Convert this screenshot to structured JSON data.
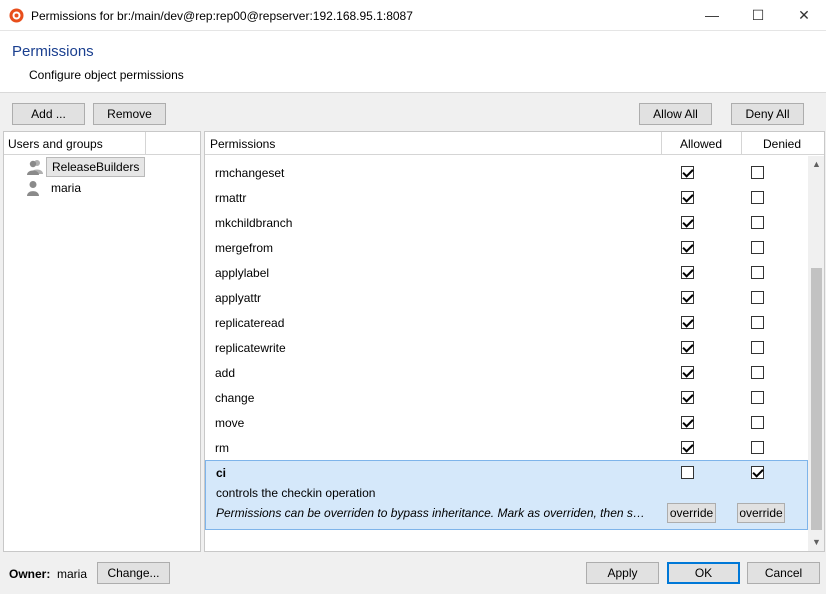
{
  "window": {
    "title": "Permissions for br:/main/dev@rep:rep00@repserver:192.168.95.1:8087",
    "minimize_glyph": "—",
    "maximize_glyph": "☐",
    "close_glyph": "✕"
  },
  "header": {
    "title": "Permissions",
    "subtitle": "Configure object permissions"
  },
  "toolbar": {
    "add_label": "Add ...",
    "remove_label": "Remove",
    "allow_all_label": "Allow All",
    "deny_all_label": "Deny All"
  },
  "users_panel": {
    "header": "Users and groups",
    "items": [
      {
        "label": "ReleaseBuilders",
        "kind": "group",
        "selected": true
      },
      {
        "label": "maria",
        "kind": "user",
        "selected": false
      }
    ]
  },
  "permissions_grid": {
    "columns": {
      "name": "Permissions",
      "allowed": "Allowed",
      "denied": "Denied"
    },
    "rows": [
      {
        "name": "rmchangeset",
        "allowed": true,
        "denied": false
      },
      {
        "name": "rmattr",
        "allowed": true,
        "denied": false
      },
      {
        "name": "mkchildbranch",
        "allowed": true,
        "denied": false
      },
      {
        "name": "mergefrom",
        "allowed": true,
        "denied": false
      },
      {
        "name": "applylabel",
        "allowed": true,
        "denied": false
      },
      {
        "name": "applyattr",
        "allowed": true,
        "denied": false
      },
      {
        "name": "replicateread",
        "allowed": true,
        "denied": false
      },
      {
        "name": "replicatewrite",
        "allowed": true,
        "denied": false
      },
      {
        "name": "add",
        "allowed": true,
        "denied": false
      },
      {
        "name": "change",
        "allowed": true,
        "denied": false
      },
      {
        "name": "move",
        "allowed": true,
        "denied": false
      },
      {
        "name": "rm",
        "allowed": true,
        "denied": false
      }
    ],
    "selected_row": {
      "name": "ci",
      "description": "controls the checkin operation",
      "note": "Permissions can be overriden to bypass inheritance. Mark as overriden, then set the permission.",
      "allowed": false,
      "denied": true,
      "override_allowed_label": "override",
      "override_denied_label": "override"
    },
    "scrollbar": {
      "up_glyph": "▲",
      "down_glyph": "▼"
    }
  },
  "footer": {
    "owner_label": "Owner:",
    "owner_value": "maria",
    "change_label": "Change...",
    "apply_label": "Apply",
    "ok_label": "OK",
    "cancel_label": "Cancel"
  },
  "colors": {
    "title_accent": "#1a3f8f",
    "app_icon": "#e84e1b",
    "selection_bg": "#d5e8fa",
    "selection_border": "#7eb4ea",
    "default_button_border": "#0078d7"
  }
}
